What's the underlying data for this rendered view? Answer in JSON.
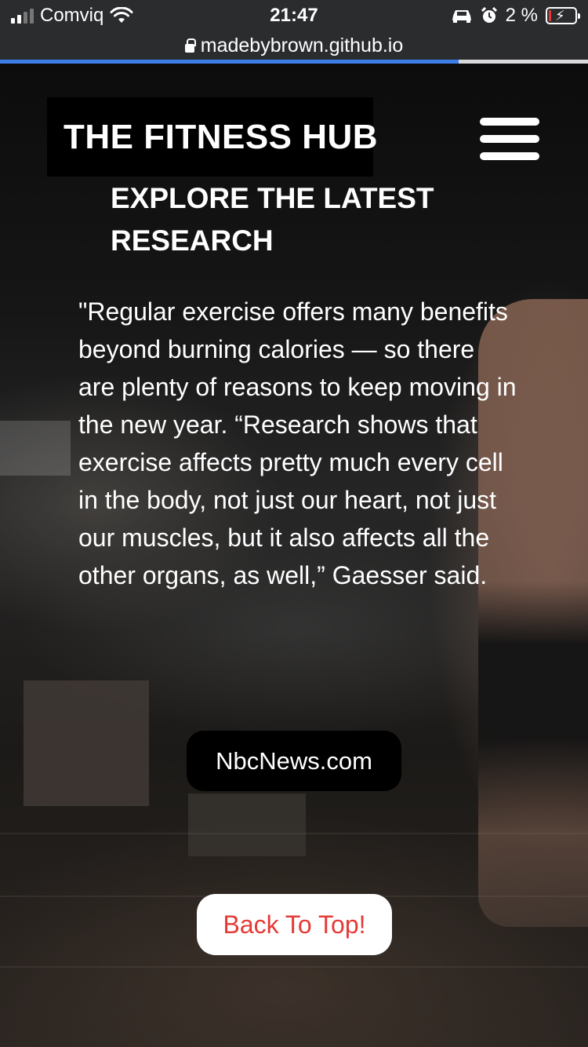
{
  "status_bar": {
    "carrier": "Comviq",
    "time": "21:47",
    "battery_percent": "2 %"
  },
  "browser": {
    "url": "madebybrown.github.io",
    "load_progress": 0.78
  },
  "header": {
    "logo_text": "THE FITNESS HUB"
  },
  "main": {
    "headline": "EXPLORE THE LATEST RESEARCH",
    "quote": "\"Regular exercise offers many benefits beyond burning calories — so there are plenty of reasons to keep moving in the new year. “Research shows that exercise affects pretty much every cell in the body, not just our heart, not just our muscles, but it also affects all the other organs, as well,” Gaesser said.",
    "source_button": "NbcNews.com",
    "back_to_top": "Back To Top!"
  },
  "colors": {
    "accent_red": "#e53935",
    "progress_blue": "#3d7ee8"
  }
}
